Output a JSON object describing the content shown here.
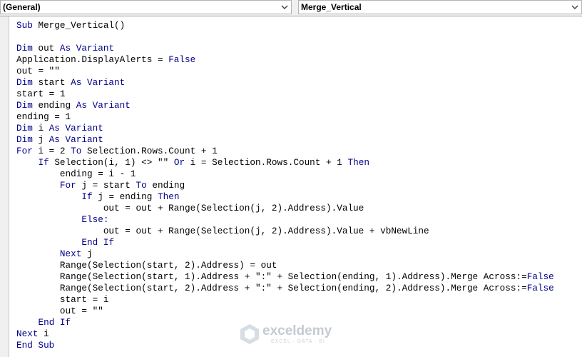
{
  "toolbar": {
    "object_combo": {
      "value": "(General)",
      "icon": "chevron-down-icon"
    },
    "procedure_combo": {
      "value": "Merge_Vertical",
      "icon": "chevron-down-icon"
    }
  },
  "editor": {
    "keyword_color": "#00008b",
    "text_color": "#000000",
    "lines": [
      [
        {
          "k": "Sub"
        },
        {
          "t": " Merge_Vertical()"
        }
      ],
      [],
      [
        {
          "k": "Dim"
        },
        {
          "t": " out "
        },
        {
          "k": "As Variant"
        }
      ],
      [
        {
          "t": "Application.DisplayAlerts = "
        },
        {
          "k": "False"
        }
      ],
      [
        {
          "t": "out = \"\""
        }
      ],
      [
        {
          "k": "Dim"
        },
        {
          "t": " start "
        },
        {
          "k": "As Variant"
        }
      ],
      [
        {
          "t": "start = 1"
        }
      ],
      [
        {
          "k": "Dim"
        },
        {
          "t": " ending "
        },
        {
          "k": "As Variant"
        }
      ],
      [
        {
          "t": "ending = 1"
        }
      ],
      [
        {
          "k": "Dim"
        },
        {
          "t": " i "
        },
        {
          "k": "As Variant"
        }
      ],
      [
        {
          "k": "Dim"
        },
        {
          "t": " j "
        },
        {
          "k": "As Variant"
        }
      ],
      [
        {
          "k": "For"
        },
        {
          "t": " i = 2 "
        },
        {
          "k": "To"
        },
        {
          "t": " Selection.Rows.Count + 1"
        }
      ],
      [
        {
          "t": "    "
        },
        {
          "k": "If"
        },
        {
          "t": " Selection(i, 1) <> \"\" "
        },
        {
          "k": "Or"
        },
        {
          "t": " i = Selection.Rows.Count + 1 "
        },
        {
          "k": "Then"
        }
      ],
      [
        {
          "t": "        ending = i - 1"
        }
      ],
      [
        {
          "t": "        "
        },
        {
          "k": "For"
        },
        {
          "t": " j = start "
        },
        {
          "k": "To"
        },
        {
          "t": " ending"
        }
      ],
      [
        {
          "t": "            "
        },
        {
          "k": "If"
        },
        {
          "t": " j = ending "
        },
        {
          "k": "Then"
        }
      ],
      [
        {
          "t": "                out = out + Range(Selection(j, 2).Address).Value"
        }
      ],
      [
        {
          "t": "            "
        },
        {
          "k": "Else:"
        }
      ],
      [
        {
          "t": "                out = out + Range(Selection(j, 2).Address).Value + vbNewLine"
        }
      ],
      [
        {
          "t": "            "
        },
        {
          "k": "End If"
        }
      ],
      [
        {
          "t": "        "
        },
        {
          "k": "Next"
        },
        {
          "t": " j"
        }
      ],
      [
        {
          "t": "        Range(Selection(start, 2).Address) = out"
        }
      ],
      [
        {
          "t": "        Range(Selection(start, 1).Address + \":\" + Selection(ending, 1).Address).Merge Across:="
        },
        {
          "k": "False"
        }
      ],
      [
        {
          "t": "        Range(Selection(start, 2).Address + \":\" + Selection(ending, 2).Address).Merge Across:="
        },
        {
          "k": "False"
        }
      ],
      [
        {
          "t": "        start = i"
        }
      ],
      [
        {
          "t": "        out = \"\""
        }
      ],
      [
        {
          "t": "    "
        },
        {
          "k": "End If"
        }
      ],
      [
        {
          "k": "Next"
        },
        {
          "t": " i"
        }
      ],
      [
        {
          "k": "End Sub"
        }
      ]
    ]
  },
  "watermark": {
    "name": "exceldemy",
    "tagline": "EXCEL · DATA · BI",
    "icon": "exceldemy-logo-icon"
  }
}
